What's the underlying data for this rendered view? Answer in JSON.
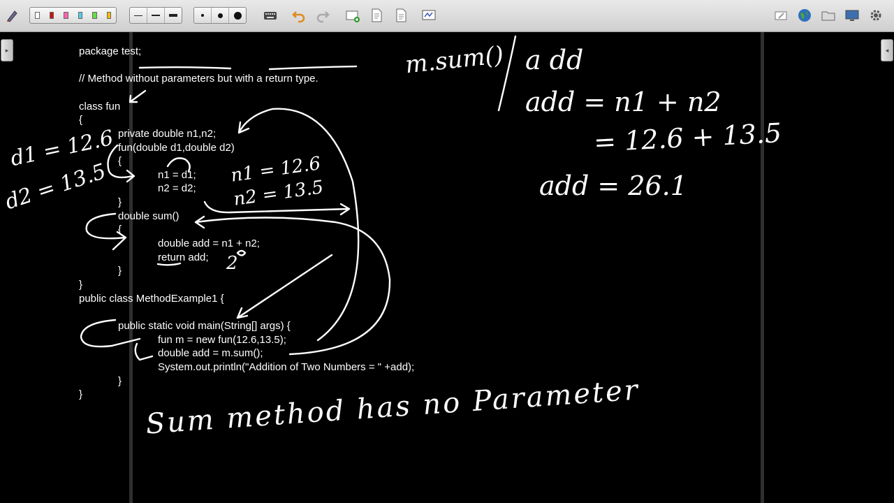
{
  "toolbar": {
    "pen_colors": [
      "#ffffff",
      "#d01010",
      "#ff66aa",
      "#55ccee",
      "#66dd44",
      "#ffbb00"
    ],
    "tools": [
      "pen-icon",
      "pen-color-palette",
      "line-width-selector",
      "point-size-selector",
      "keyboard-icon",
      "undo-icon",
      "redo-icon",
      "new-page-icon",
      "document-icon",
      "document-pages-icon",
      "whiteboard-icon",
      "eraser-icon",
      "globe-icon",
      "folder-icon",
      "display-icon",
      "settings-icon"
    ]
  },
  "code_lines": [
    "package test;",
    "// Method without parameters but with a return type.",
    "class fun",
    "{",
    "private double n1,n2;",
    "fun(double d1,double d2)",
    "{",
    "n1 = d1;",
    "n2 = d2;",
    "}",
    "double sum()",
    "{",
    "double add = n1 + n2;",
    "return add;",
    "}",
    "}",
    "public class MethodExample1 {",
    "public static void main(String[] args) {",
    "fun m = new fun(12.6,13.5);",
    "double add = m.sum();",
    "System.out.println(\"Addition of Two Numbers = \" +add);",
    "}",
    "}"
  ],
  "handwriting": {
    "d1": "d1 = 12.6",
    "d2": "d2 = 13.5",
    "n1": "n1 = 12.6",
    "n2": "n2 = 13.5",
    "two": "2",
    "msum": "m.sum()",
    "a_dd": "a dd",
    "eq1": "add = n1 + n2",
    "eq2": "= 12.6 + 13.5",
    "eq3": "add = 26.1",
    "note": "Sum method has no Parameter"
  }
}
